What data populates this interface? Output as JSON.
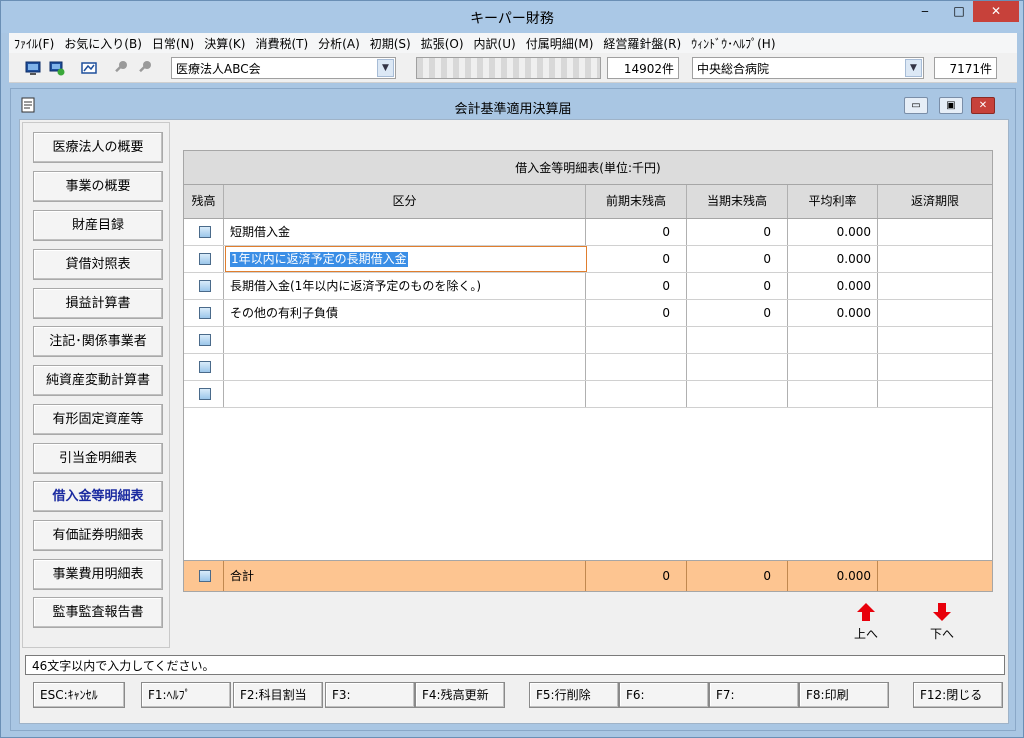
{
  "app": {
    "title": "キーパー財務",
    "window_controls": {
      "minimize": "‒",
      "maximize": "□",
      "close": "✕"
    }
  },
  "menu": [
    "ﾌｧｲﾙ(F)",
    "お気に入り(B)",
    "日常(N)",
    "決算(K)",
    "消費税(T)",
    "分析(A)",
    "初期(S)",
    "拡張(O)",
    "内訳(U)",
    "付属明細(M)",
    "経営羅針盤(R)",
    "ｳｨﾝﾄﾞｳ･ﾍﾙﾌﾟ(H)"
  ],
  "toolbar": {
    "corporation": "医療法人ABC会",
    "count1": "14902件",
    "hospital": "中央総合病院",
    "count2": "7171件",
    "dropdown_icon": "▼"
  },
  "inner_window": {
    "title": "会計基準適用決算届",
    "controls": {
      "minimize": "▭",
      "maximize": "▣",
      "close": "✕"
    }
  },
  "sidebar": {
    "items": [
      "医療法人の概要",
      "事業の概要",
      "財産目録",
      "貸借対照表",
      "損益計算書",
      "注記･関係事業者",
      "純資産変動計算書",
      "有形固定資産等",
      "引当金明細表",
      "借入金等明細表",
      "有価証券明細表",
      "事業費用明細表",
      "監事監査報告書"
    ],
    "active": "借入金等明細表"
  },
  "grid": {
    "title": "借入金等明細表(単位:千円)",
    "columns": [
      "残高",
      "区分",
      "前期末残高",
      "当期末残高",
      "平均利率",
      "返済期限"
    ],
    "rows": [
      {
        "label": "短期借入金",
        "prev": "0",
        "curr": "0",
        "rate": "0.000",
        "due": ""
      },
      {
        "label": "1年以内に返済予定の長期借入金",
        "prev": "0",
        "curr": "0",
        "rate": "0.000",
        "due": ""
      },
      {
        "label": "長期借入金(1年以内に返済予定のものを除く。)",
        "prev": "0",
        "curr": "0",
        "rate": "0.000",
        "due": ""
      },
      {
        "label": "その他の有利子負債",
        "prev": "0",
        "curr": "0",
        "rate": "0.000",
        "due": ""
      },
      {
        "label": "",
        "prev": "",
        "curr": "",
        "rate": "",
        "due": ""
      },
      {
        "label": "",
        "prev": "",
        "curr": "",
        "rate": "",
        "due": ""
      },
      {
        "label": "",
        "prev": "",
        "curr": "",
        "rate": "",
        "due": ""
      }
    ],
    "total": {
      "label": "合計",
      "prev": "0",
      "curr": "0",
      "rate": "0.000",
      "due": ""
    }
  },
  "nav_arrows": {
    "up": "上へ",
    "down": "下へ"
  },
  "status": "46文字以内で入力してください。",
  "fkeys": [
    "ESC:ｷｬﾝｾﾙ",
    "F1:ﾍﾙﾌﾟ",
    "F2:科目割当",
    "F3:",
    "F4:残高更新",
    "F5:行削除",
    "F6:",
    "F7:",
    "F8:印刷",
    "F12:閉じる"
  ],
  "colors": {
    "titlebar": "#aac8e6",
    "close_button": "#c7413a",
    "total_row": "#fdc591",
    "selection": "#3a8ee6",
    "active_nav": "#1a2aa0",
    "arrow": "#e8000b"
  }
}
